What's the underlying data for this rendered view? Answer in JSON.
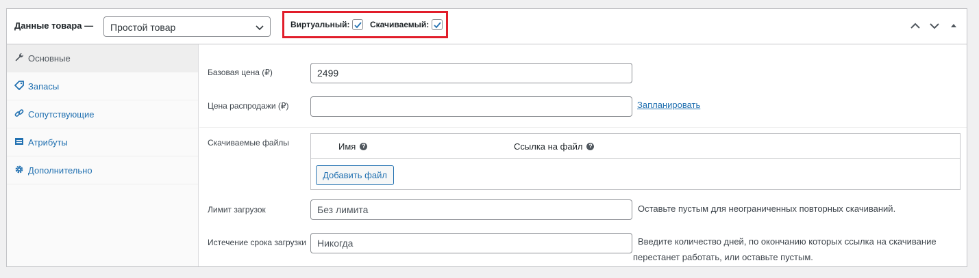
{
  "header": {
    "title": "Данные товара —",
    "product_type": "Простой товар",
    "virtual_label": "Виртуальный:",
    "virtual_checked": true,
    "downloadable_label": "Скачиваемый:",
    "downloadable_checked": true,
    "highlight_color": "#e11d2a"
  },
  "sidebar": {
    "items": [
      {
        "label": "Основные",
        "icon": "wrench-icon",
        "active": true
      },
      {
        "label": "Запасы",
        "icon": "tag-icon",
        "active": false
      },
      {
        "label": "Сопутствующие",
        "icon": "link-icon",
        "active": false
      },
      {
        "label": "Атрибуты",
        "icon": "list-icon",
        "active": false
      },
      {
        "label": "Дополнительно",
        "icon": "gear-icon",
        "active": false
      }
    ]
  },
  "general": {
    "regular_price_label": "Базовая цена (₽)",
    "regular_price_value": "2499",
    "sale_price_label": "Цена распродажи (₽)",
    "sale_price_value": "",
    "schedule_link": "Запланировать",
    "files_label": "Скачиваемые файлы",
    "files_col_name": "Имя",
    "files_col_url": "Ссылка на файл",
    "add_file_button": "Добавить файл",
    "download_limit_label": "Лимит загрузок",
    "download_limit_placeholder": "Без лимита",
    "download_limit_hint": "Оставьте пустым для неограниченных повторных скачиваний.",
    "download_expiry_label": "Истечение срока загрузки",
    "download_expiry_placeholder": "Никогда",
    "download_expiry_hint_1": "Введите количество дней, по окончанию которых ссылка на скачивание",
    "download_expiry_hint_2": "перестанет работать, или оставьте пустым."
  },
  "colors": {
    "link": "#2271b1",
    "border": "#c3c4c7"
  }
}
